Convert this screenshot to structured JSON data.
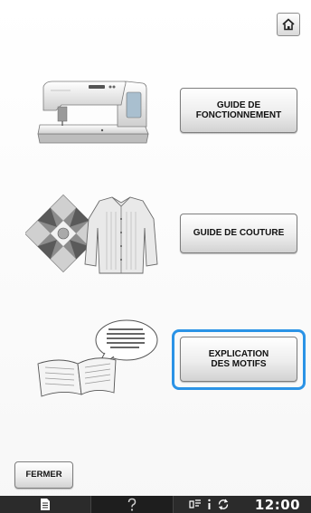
{
  "home": {
    "icon": "home-icon"
  },
  "buttons": {
    "operation_line1": "GUIDE DE",
    "operation_line2": "FONCTIONNEMENT",
    "sewing": "GUIDE DE COUTURE",
    "pattern_line1": "EXPLICATION",
    "pattern_line2": "DES MOTIFS",
    "close": "FERMER"
  },
  "status_bar": {
    "time": "12:00",
    "icons": [
      "document-icon",
      "help-icon",
      "needle-icon",
      "info-icon",
      "sync-icon"
    ]
  },
  "colors": {
    "selection": "#2b93e6",
    "status_bar": "#2b2b2b"
  }
}
